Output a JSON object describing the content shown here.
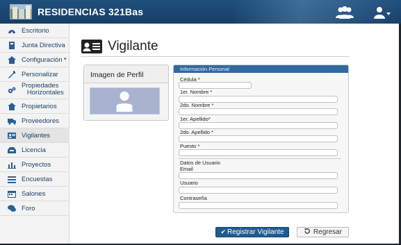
{
  "header": {
    "app_title": "RESIDENCIAS 321Bas",
    "icons": [
      "building-logo",
      "users-icon",
      "user-menu-icon"
    ]
  },
  "sidebar": {
    "items": [
      {
        "label": "Escritorio",
        "icon": "dashboard-icon"
      },
      {
        "label": "Junta Directiva",
        "icon": "book-icon"
      },
      {
        "label": "Configuración",
        "icon": "home-icon",
        "caret": "▾"
      },
      {
        "label": "Personalizar",
        "icon": "wrench-icon"
      },
      {
        "label": "Propiedades\nHorizontales",
        "icon": "gears-icon"
      },
      {
        "label": "Propietarios",
        "icon": "home-icon"
      },
      {
        "label": "Proveedores",
        "icon": "truck-icon"
      },
      {
        "label": "Vigilantes",
        "icon": "id-card-icon",
        "active": true
      },
      {
        "label": "Licencia",
        "icon": "inbox-icon"
      },
      {
        "label": "Proyectos",
        "icon": "bar-chart-icon"
      },
      {
        "label": "Encuestas",
        "icon": "list-icon"
      },
      {
        "label": "Salones",
        "icon": "calendar-icon"
      },
      {
        "label": "Foro",
        "icon": "chat-icon"
      }
    ]
  },
  "main": {
    "page_title": "Vigilante",
    "profile_card": {
      "title": "Imagen de Perfil"
    },
    "form": {
      "legend": "Información Personal",
      "fields": {
        "cedula": {
          "label": "Cédula *",
          "value": ""
        },
        "nombre1": {
          "label": "1er. Nombre *",
          "value": ""
        },
        "nombre2": {
          "label": "2do. Nombre *",
          "value": ""
        },
        "apellido1": {
          "label": "1er. Apellido*",
          "value": ""
        },
        "apellido2": {
          "label": "2do. Apellido *",
          "value": ""
        },
        "puesto": {
          "label": "Puesto *",
          "value": ""
        },
        "datos_usuario": {
          "label": "Datos de Usuario"
        },
        "email": {
          "label": "Email",
          "value": ""
        },
        "usuario": {
          "label": "Usuario",
          "value": ""
        },
        "contrasena": {
          "label": "Contraseña",
          "value": ""
        }
      }
    },
    "buttons": {
      "register": "Registrar Vigilante",
      "back": "Regresar"
    }
  },
  "colors": {
    "header": "#1f4f7e",
    "primary": "#215a91",
    "legend": "#2e6aa0",
    "sidebar_text": "#1b3f66",
    "avatar": "#a9b3cf"
  }
}
